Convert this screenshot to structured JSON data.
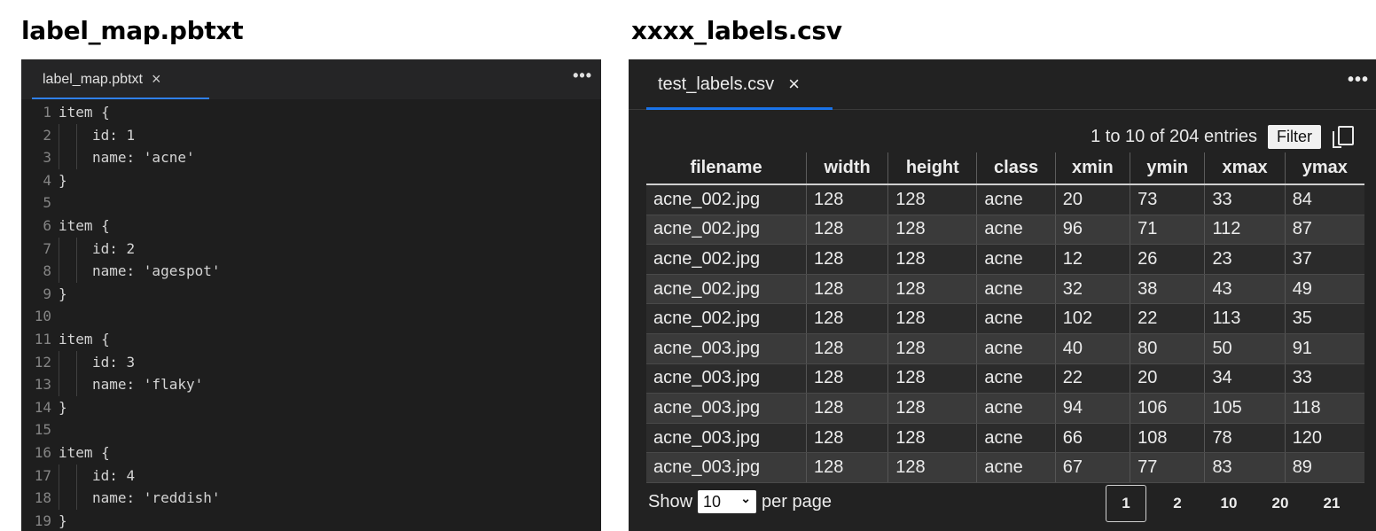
{
  "headings": {
    "left": "label_map.pbtxt",
    "right": "xxxx_labels.csv"
  },
  "editor": {
    "tab_label": "label_map.pbtxt",
    "close_glyph": "×",
    "more_glyph": "•••",
    "lines": [
      {
        "n": "1",
        "text": "item {"
      },
      {
        "n": "2",
        "text": "id: 1"
      },
      {
        "n": "3",
        "text": "name: 'acne'"
      },
      {
        "n": "4",
        "text": "}"
      },
      {
        "n": "5",
        "text": ""
      },
      {
        "n": "6",
        "text": "item {"
      },
      {
        "n": "7",
        "text": "id: 2"
      },
      {
        "n": "8",
        "text": "name: 'agespot'"
      },
      {
        "n": "9",
        "text": "}"
      },
      {
        "n": "10",
        "text": ""
      },
      {
        "n": "11",
        "text": "item {"
      },
      {
        "n": "12",
        "text": "id: 3"
      },
      {
        "n": "13",
        "text": "name: 'flaky'"
      },
      {
        "n": "14",
        "text": "}"
      },
      {
        "n": "15",
        "text": ""
      },
      {
        "n": "16",
        "text": "item {"
      },
      {
        "n": "17",
        "text": "id: 4"
      },
      {
        "n": "18",
        "text": "name: 'reddish'"
      },
      {
        "n": "19",
        "text": "}"
      }
    ]
  },
  "viewer": {
    "tab_label": "test_labels.csv",
    "close_glyph": "×",
    "more_glyph": "•••",
    "summary": "1 to 10 of 204 entries",
    "filter_label": "Filter",
    "columns": [
      "filename",
      "width",
      "height",
      "class",
      "xmin",
      "ymin",
      "xmax",
      "ymax"
    ],
    "rows": [
      [
        "acne_002.jpg",
        "128",
        "128",
        "acne",
        "20",
        "73",
        "33",
        "84"
      ],
      [
        "acne_002.jpg",
        "128",
        "128",
        "acne",
        "96",
        "71",
        "112",
        "87"
      ],
      [
        "acne_002.jpg",
        "128",
        "128",
        "acne",
        "12",
        "26",
        "23",
        "37"
      ],
      [
        "acne_002.jpg",
        "128",
        "128",
        "acne",
        "32",
        "38",
        "43",
        "49"
      ],
      [
        "acne_002.jpg",
        "128",
        "128",
        "acne",
        "102",
        "22",
        "113",
        "35"
      ],
      [
        "acne_003.jpg",
        "128",
        "128",
        "acne",
        "40",
        "80",
        "50",
        "91"
      ],
      [
        "acne_003.jpg",
        "128",
        "128",
        "acne",
        "22",
        "20",
        "34",
        "33"
      ],
      [
        "acne_003.jpg",
        "128",
        "128",
        "acne",
        "94",
        "106",
        "105",
        "118"
      ],
      [
        "acne_003.jpg",
        "128",
        "128",
        "acne",
        "66",
        "108",
        "78",
        "120"
      ],
      [
        "acne_003.jpg",
        "128",
        "128",
        "acne",
        "67",
        "77",
        "83",
        "89"
      ]
    ],
    "footer": {
      "show_label": "Show",
      "page_size": "10",
      "per_page_label": "per page"
    },
    "pages": [
      "1",
      "2",
      "10",
      "20",
      "21"
    ],
    "current_page": "1"
  },
  "colors": {
    "editor_bg": "#1e1e1e",
    "viewer_bg": "#222222",
    "accent": "#1a73e8"
  }
}
